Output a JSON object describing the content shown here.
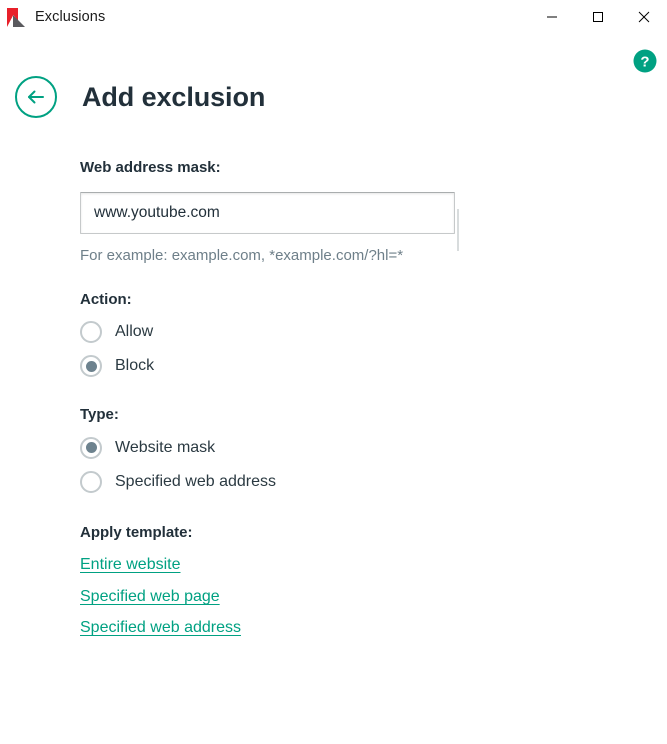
{
  "window": {
    "title": "Exclusions",
    "logo_icon": "kaspersky-k-logo",
    "controls": {
      "minimize": "minimize-icon",
      "maximize": "maximize-icon",
      "close": "close-icon"
    }
  },
  "help": {
    "icon": "question-mark-help-icon",
    "label": "?"
  },
  "header": {
    "back_icon": "arrow-left-icon",
    "title": "Add exclusion"
  },
  "form": {
    "address": {
      "label": "Web address mask:",
      "value": "www.youtube.com",
      "placeholder": "",
      "hint": "For example: example.com, *example.com/?hl=*"
    },
    "action": {
      "label": "Action:",
      "selected": "Block",
      "options": [
        {
          "label": "Allow",
          "selected": false
        },
        {
          "label": "Block",
          "selected": true
        }
      ]
    },
    "type": {
      "label": "Type:",
      "selected": "Website mask",
      "options": [
        {
          "label": "Website mask",
          "selected": true
        },
        {
          "label": "Specified web address",
          "selected": false
        }
      ]
    },
    "template": {
      "label": "Apply template:",
      "links": [
        {
          "label": "Entire website"
        },
        {
          "label": "Specified web page"
        },
        {
          "label": "Specified web address"
        }
      ]
    }
  },
  "colors": {
    "accent_green": "#00a182",
    "link_green": "#00a182",
    "radio_dot": "#6d828e",
    "text_dark": "#22303a",
    "hint_gray": "#6e7f89",
    "logo_red": "#e8202a"
  }
}
